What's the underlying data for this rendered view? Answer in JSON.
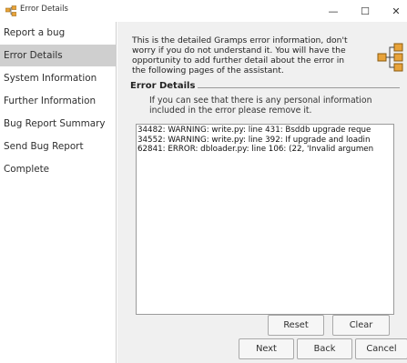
{
  "window": {
    "title": "Error Details",
    "minimize_glyph": "—",
    "maximize_glyph": "☐",
    "close_glyph": "✕"
  },
  "sidebar": {
    "items": [
      {
        "label": "Report a bug",
        "active": false
      },
      {
        "label": "Error Details",
        "active": true
      },
      {
        "label": "System Information",
        "active": false
      },
      {
        "label": "Further Information",
        "active": false
      },
      {
        "label": "Bug Report Summary",
        "active": false
      },
      {
        "label": "Send Bug Report",
        "active": false
      },
      {
        "label": "Complete",
        "active": false
      }
    ]
  },
  "main": {
    "intro_lines": [
      "This is the detailed Gramps error information, don't",
      "worry if you do not understand it. You will have the",
      "opportunity to add further detail about the error in",
      "the following pages of the assistant."
    ],
    "group_label": "Error Details",
    "note_lines": [
      "If you can see that there is any personal information",
      "included in the error please remove it."
    ],
    "log_lines": [
      "34482: WARNING: write.py: line 431: Bsddb upgrade reque",
      "34552: WARNING: write.py: line 392: If upgrade and loadin",
      "62841: ERROR: dbloader.py: line 106: (22, 'Invalid argumen"
    ],
    "reset_label": "Reset",
    "clear_label": "Clear"
  },
  "footer": {
    "next_label": "Next",
    "back_label": "Back",
    "cancel_label": "Cancel"
  },
  "colors": {
    "sidebar_active": "#cfcfcf",
    "main_bg": "#f0f0f0",
    "icon_orange": "#e8a33a"
  }
}
